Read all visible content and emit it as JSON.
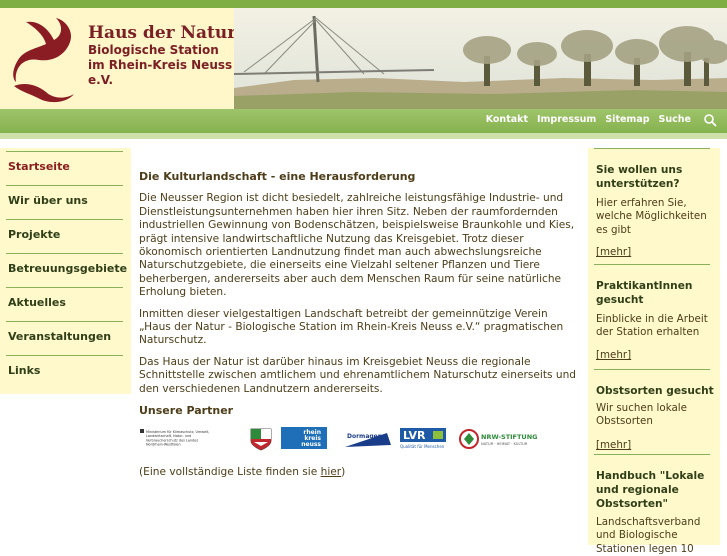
{
  "header": {
    "title": "Haus der Natur",
    "subtitle": "Biologische Station im Rhein-Kreis Neuss e.V."
  },
  "topnav": [
    "Kontakt",
    "Impressum",
    "Sitemap",
    "Suche"
  ],
  "leftnav": [
    {
      "label": "Startseite",
      "active": true
    },
    {
      "label": "Wir über uns",
      "active": false
    },
    {
      "label": "Projekte",
      "active": false
    },
    {
      "label": "Betreuungsgebiete",
      "active": false
    },
    {
      "label": "Aktuelles",
      "active": false
    },
    {
      "label": "Veranstaltungen",
      "active": false
    },
    {
      "label": "Links",
      "active": false
    }
  ],
  "main": {
    "heading": "Die Kulturlandschaft - eine Herausforderung",
    "p1": "Die Neusser Region ist dicht besiedelt, zahlreiche leistungsfähige Industrie- und Dienstleistungsunternehmen haben hier ihren Sitz. Neben der raumfordernden industriellen Gewinnung von Bodenschätzen, beispielsweise Braunkohle und Kies, prägt intensive landwirtschaftliche Nutzung das Kreisgebiet. Trotz dieser ökonomisch orientierten Landnutzung findet man auch abwechslungsreiche Naturschutzgebiete, die einerseits eine Vielzahl seltener Pflanzen und Tiere beherbergen, andererseits aber auch dem Menschen Raum für seine natürliche Erholung bieten.",
    "p2": "Inmitten dieser vielgestaltigen Landschaft betreibt der gemeinnützige Verein „Haus der Natur - Biologische Station im Rhein-Kreis Neuss e.V.“ pragmatischen Naturschutz.",
    "p3": "Das Haus der Natur ist darüber hinaus im Kreisgebiet Neuss die regionale Schnittstelle zwischen amtlichem und ehrenamtlichem Naturschutz einerseits und den verschiedenen Landnutzern andererseits.",
    "partners_heading": "Unsere Partner",
    "partners": {
      "ministry": "Ministerium für Klimaschutz, Umwelt, Landwirtschaft, Natur- und Verbraucherschutz des Landes Nordrhein-Westfalen",
      "rhein": "rhein",
      "kreis": "kreis",
      "neuss": "neuss",
      "dormagen": "Dormagen",
      "lvr": "LVR",
      "lvr_sub": "Qualität für Menschen",
      "nrw": "NRW-STIFTUNG",
      "nrw_sub": "NATUR · HEIMAT · KULTUR"
    },
    "list_pre": "(Eine vollständige Liste finden sie ",
    "list_link": "hier",
    "list_post": ")"
  },
  "sidebar": [
    {
      "heading": "Sie wollen uns unterstützen?",
      "text": "Hier erfahren Sie, welche Möglichkeiten es gibt",
      "link": "[mehr]"
    },
    {
      "heading": "PraktikantInnen gesucht",
      "text": "Einblicke in die Arbeit der Station erhalten",
      "link": "[mehr]"
    },
    {
      "heading": "Obstsorten gesucht",
      "text": "Wir suchen lokale Obstsorten",
      "link": "[mehr]"
    },
    {
      "heading": "Handbuch \"Lokale und regionale Obstsorten\"",
      "text": "Landschaftsverband und Biologische Stationen legen 10",
      "link": ""
    }
  ],
  "colors": {
    "brand": "#7a1f24",
    "nav": "#86b24f",
    "cream": "#fff9cc"
  }
}
